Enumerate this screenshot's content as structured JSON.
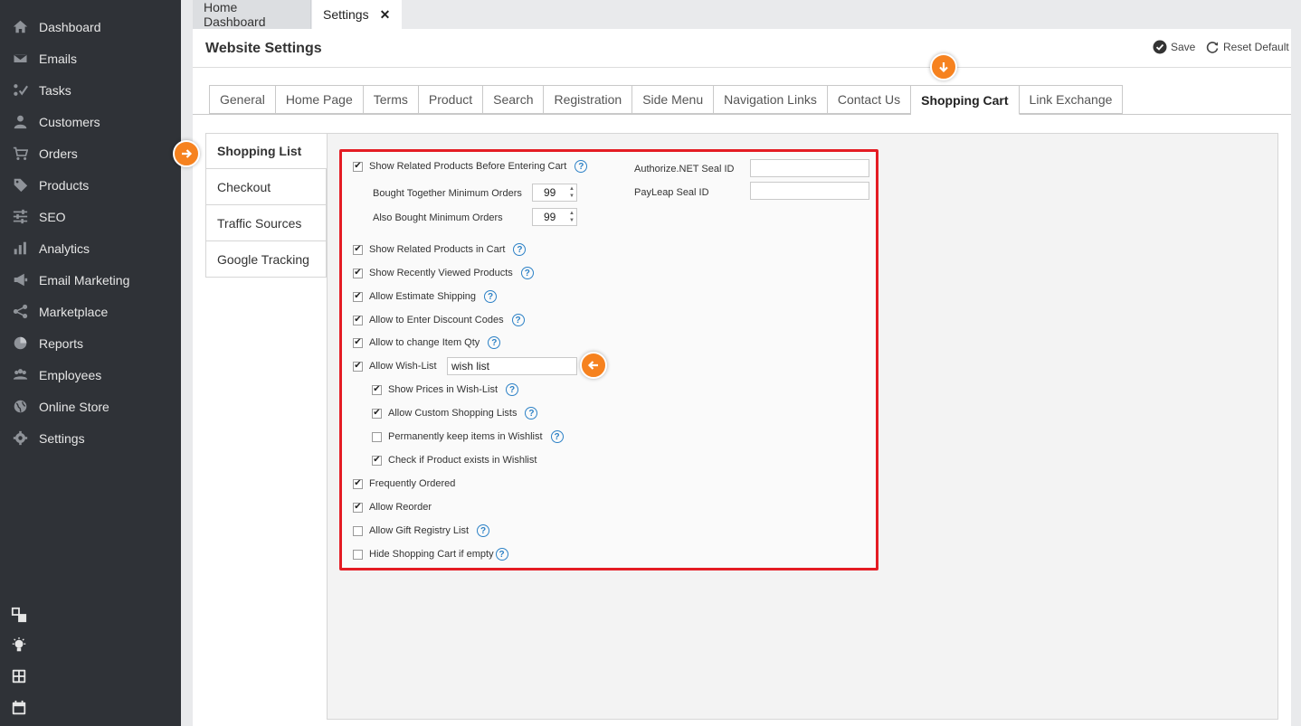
{
  "sidebar": {
    "items": [
      {
        "label": "Dashboard",
        "icon": "home-icon"
      },
      {
        "label": "Emails",
        "icon": "envelope-icon"
      },
      {
        "label": "Tasks",
        "icon": "tasks-icon"
      },
      {
        "label": "Customers",
        "icon": "user-icon"
      },
      {
        "label": "Orders",
        "icon": "cart-icon"
      },
      {
        "label": "Products",
        "icon": "tag-icon"
      },
      {
        "label": "SEO",
        "icon": "sliders-icon"
      },
      {
        "label": "Analytics",
        "icon": "bar-chart-icon"
      },
      {
        "label": "Email Marketing",
        "icon": "megaphone-icon"
      },
      {
        "label": "Marketplace",
        "icon": "share-icon"
      },
      {
        "label": "Reports",
        "icon": "pie-chart-icon"
      },
      {
        "label": "Employees",
        "icon": "users-icon"
      },
      {
        "label": "Online Store",
        "icon": "globe-icon"
      },
      {
        "label": "Settings",
        "icon": "gear-icon"
      }
    ],
    "bottom_icons": [
      "windows-icon",
      "lightbulb-icon",
      "calculator-icon",
      "calendar-icon"
    ]
  },
  "top_tabs": [
    {
      "label": "Home Dashboard"
    },
    {
      "label": "Settings",
      "close": "✕"
    }
  ],
  "header": {
    "title": "Website Settings",
    "save_label": "Save",
    "reset_label": "Reset Default"
  },
  "tabs": [
    "General",
    "Home Page",
    "Terms",
    "Product",
    "Search",
    "Registration",
    "Side Menu",
    "Navigation Links",
    "Contact Us",
    "Shopping Cart",
    "Link Exchange"
  ],
  "active_tab": "Shopping Cart",
  "subnav": [
    "Shopping List",
    "Checkout",
    "Traffic Sources",
    "Google Tracking"
  ],
  "active_subnav": "Shopping List",
  "settings": {
    "related_before_cart": {
      "label": "Show Related Products Before Entering Cart",
      "checked": true
    },
    "bought_together": {
      "label": "Bought Together Minimum Orders",
      "value": "99"
    },
    "also_bought": {
      "label": "Also Bought Minimum Orders",
      "value": "99"
    },
    "authorize_seal": {
      "label": "Authorize.NET Seal ID",
      "value": ""
    },
    "payleap_seal": {
      "label": "PayLeap Seal ID",
      "value": ""
    },
    "related_in_cart": {
      "label": "Show Related Products in Cart",
      "checked": true
    },
    "recently_viewed": {
      "label": "Show Recently Viewed Products",
      "checked": true
    },
    "estimate_shipping": {
      "label": "Allow Estimate Shipping",
      "checked": true
    },
    "discount_codes": {
      "label": "Allow to Enter Discount Codes",
      "checked": true
    },
    "change_qty": {
      "label": "Allow to change Item Qty",
      "checked": true
    },
    "wish_list": {
      "label": "Allow Wish-List",
      "checked": true,
      "value": "wish list"
    },
    "wish_prices": {
      "label": "Show Prices in Wish-List",
      "checked": true
    },
    "custom_lists": {
      "label": "Allow Custom Shopping Lists",
      "checked": true
    },
    "keep_items": {
      "label": "Permanently keep items in Wishlist",
      "checked": false
    },
    "check_exists": {
      "label": "Check if Product exists in Wishlist",
      "checked": true
    },
    "frequently_ordered": {
      "label": "Frequently Ordered",
      "checked": true
    },
    "reorder": {
      "label": "Allow Reorder",
      "checked": true
    },
    "gift_registry": {
      "label": "Allow Gift Registry List",
      "checked": false
    },
    "hide_cart": {
      "label": "Hide Shopping Cart if empty",
      "checked": false
    }
  },
  "glyphs": {
    "check": "✔",
    "help": "?",
    "spin_up": "▲",
    "spin_down": "▼"
  },
  "colors": {
    "accent_orange": "#f6821f",
    "highlight_red": "#e41c24",
    "help_blue": "#2c81c6",
    "sidebar_bg": "#2f3237"
  }
}
